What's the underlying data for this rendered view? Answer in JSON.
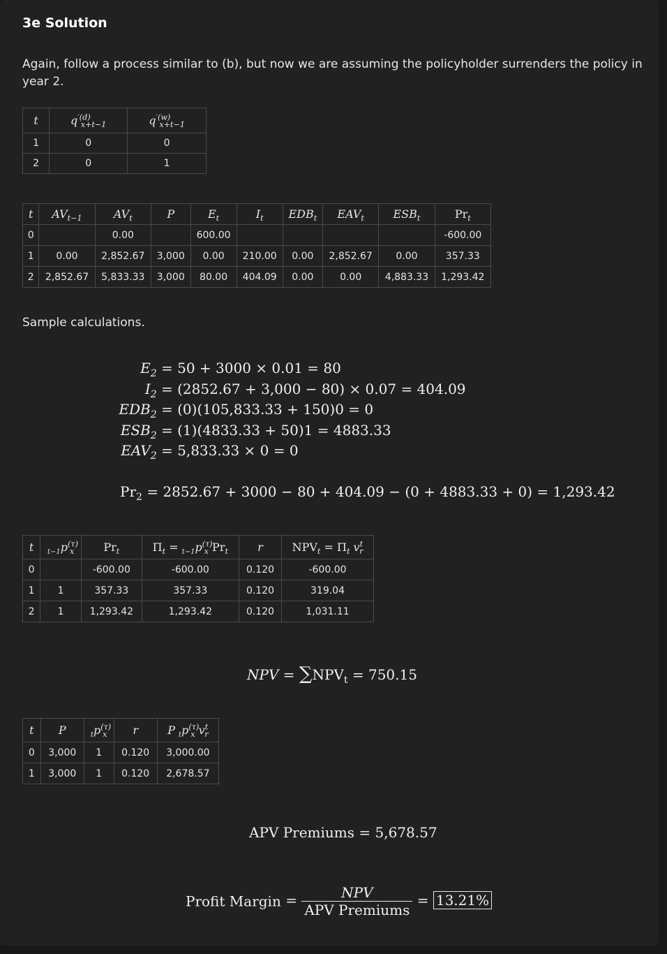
{
  "title": "3e Solution",
  "intro": "Again, follow a process similar to (b), but now we are assuming the policyholder surrenders the policy in year 2.",
  "table1": {
    "rows": [
      [
        "1",
        "0",
        "0"
      ],
      [
        "2",
        "0",
        "1"
      ]
    ]
  },
  "table2": {
    "rows": [
      [
        "0",
        "",
        "0.00",
        "",
        "600.00",
        "",
        "",
        "",
        "",
        "-600.00"
      ],
      [
        "1",
        "0.00",
        "2,852.67",
        "3,000",
        "0.00",
        "210.00",
        "0.00",
        "2,852.67",
        "0.00",
        "357.33"
      ],
      [
        "2",
        "2,852.67",
        "5,833.33",
        "3,000",
        "80.00",
        "404.09",
        "0.00",
        "0.00",
        "4,883.33",
        "1,293.42"
      ]
    ]
  },
  "sample_label": "Sample calculations.",
  "equations": {
    "e2_rhs": "= 50 + 3000 × 0.01 = 80",
    "i2_rhs": "= (2852.67 + 3,000 − 80) × 0.07 = 404.09",
    "edb2_rhs": "= (0)(105,833.33 + 150)0 = 0",
    "esb2_rhs": "= (1)(4833.33 + 50)1 = 4883.33",
    "eav2_rhs": "= 5,833.33 × 0 = 0",
    "pr2_rhs": "= 2852.67 + 3000 − 80 + 404.09 − (0 + 4883.33 + 0) = 1,293.42"
  },
  "table3": {
    "rows": [
      [
        "0",
        "",
        "-600.00",
        "-600.00",
        "0.120",
        "-600.00"
      ],
      [
        "1",
        "1",
        "357.33",
        "357.33",
        "0.120",
        "319.04"
      ],
      [
        "2",
        "1",
        "1,293.42",
        "1,293.42",
        "0.120",
        "1,031.11"
      ]
    ]
  },
  "npv_result": "750.15",
  "table4": {
    "rows": [
      [
        "0",
        "3,000",
        "1",
        "0.120",
        "3,000.00"
      ],
      [
        "1",
        "3,000",
        "1",
        "0.120",
        "2,678.57"
      ]
    ]
  },
  "apv_premiums_label": "APV Premiums",
  "apv_premiums_value": "5,678.57",
  "profit_margin_label": "Profit Margin",
  "profit_margin_value": "13.21%"
}
